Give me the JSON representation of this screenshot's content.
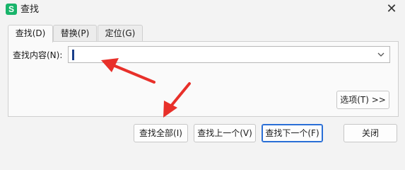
{
  "window": {
    "title": "查找",
    "app_icon_letter": "S",
    "app_icon_color": "#18b46a"
  },
  "tabs": [
    {
      "label": "查找(D)",
      "active": true
    },
    {
      "label": "替换(P)",
      "active": false
    },
    {
      "label": "定位(G)",
      "active": false
    }
  ],
  "find": {
    "label": "查找内容(N):",
    "value": ""
  },
  "buttons": {
    "options": "选项(T) >>",
    "find_all": "查找全部(I)",
    "find_prev": "查找上一个(V)",
    "find_next": "查找下一个(F)",
    "close": "关闭"
  },
  "colors": {
    "accent": "#2a6fd6",
    "annotation_arrow": "#e8302a"
  }
}
